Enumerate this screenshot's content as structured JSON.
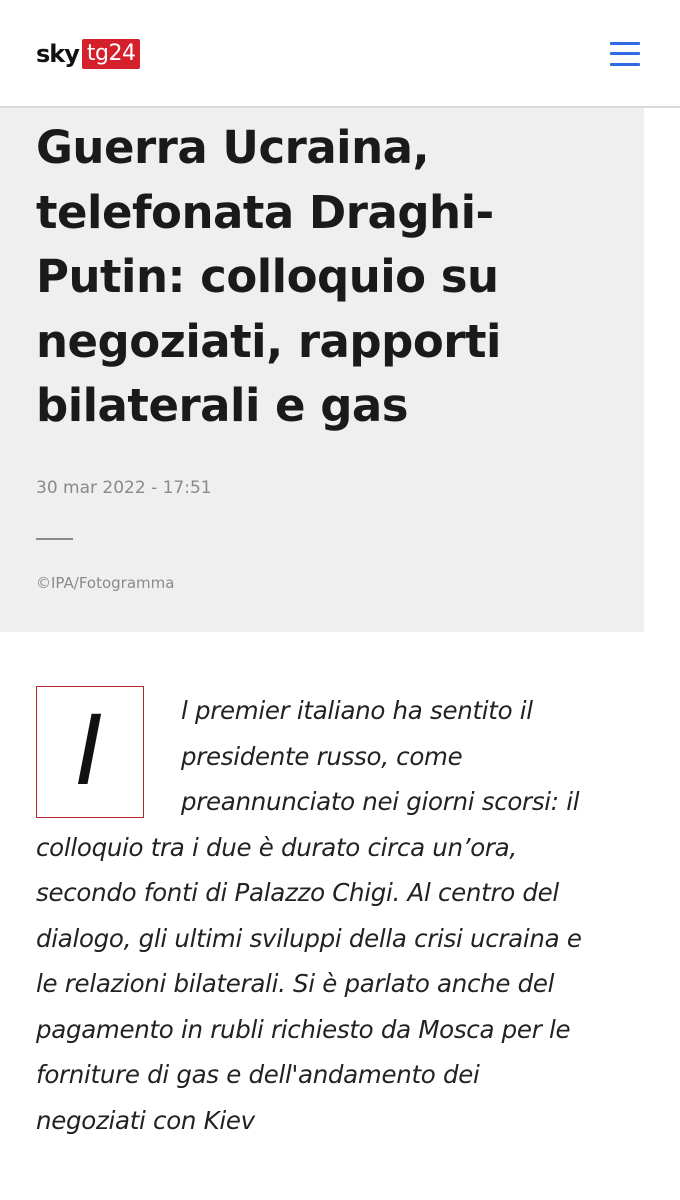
{
  "header": {
    "logo_sky": "sky",
    "logo_tg": "tg24",
    "menu_icon": "hamburger-menu-icon",
    "brand_color": "#d4202a",
    "menu_color": "#2f6be0"
  },
  "article": {
    "headline_lines": [
      "Guerra Ucraina,",
      "telefonata Draghi-",
      "Putin: colloquio su",
      "negoziati, rapporti",
      "bilaterali e gas"
    ],
    "date": "30 mar 2022 - 17:51",
    "photo_credit": "©IPA/Fotogramma",
    "dropcap": "I",
    "body_lines": [
      "l premier italiano ha sentito il",
      "presidente russo, come",
      "preannunciato nei giorni scorsi: il",
      "colloquio tra i due è durato circa un’ora,",
      "secondo fonti di Palazzo Chigi. Al centro del",
      "dialogo, gli ultimi sviluppi della crisi ucraina e",
      "le relazioni bilaterali. Si è parlato anche del",
      "pagamento in rubli richiesto da Mosca per le",
      "forniture di gas e dell'andamento dei",
      "negoziati con Kiev"
    ],
    "hero_background": "#efefef",
    "dropcap_border_color": "#b3282d"
  }
}
